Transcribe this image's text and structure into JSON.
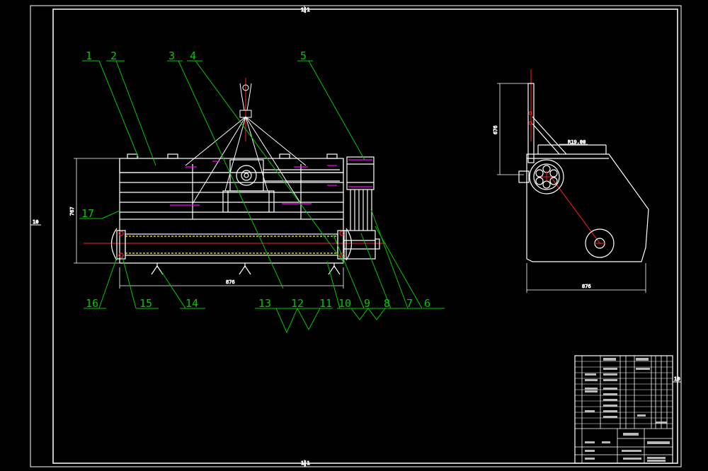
{
  "drawing": {
    "balloons": [
      "1",
      "2",
      "3",
      "4",
      "5",
      "6",
      "7",
      "8",
      "9",
      "10",
      "11",
      "12",
      "13",
      "14",
      "15",
      "16",
      "17"
    ],
    "front_view": {
      "width_dim": "876",
      "height_dim": "767"
    },
    "side_view": {
      "width_dim": "876",
      "height_dim": "676",
      "radius_dim": "R19.00"
    },
    "edge_marks": {
      "top": "1|1",
      "bottom": "1|1",
      "left": "10",
      "right": "10"
    },
    "colors": {
      "background": "#000000",
      "outline": "#ffffff",
      "leader": "#00c800",
      "centerline": "#ff2020",
      "hidden": "#ffff00",
      "bolt": "#ff00ff"
    }
  }
}
